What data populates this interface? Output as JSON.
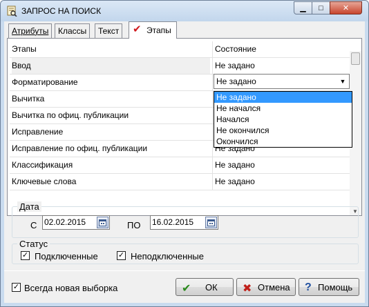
{
  "window": {
    "title": "ЗАПРОС НА ПОИСК",
    "min_glyph": "▁",
    "max_glyph": "□",
    "close_glyph": "✕"
  },
  "tabs": [
    {
      "label": "Атрибуты",
      "active": false
    },
    {
      "label": "Классы",
      "active": false
    },
    {
      "label": "Текст",
      "active": false
    },
    {
      "label": "Этапы",
      "active": true
    }
  ],
  "tab_check_glyph": "✔",
  "grid": {
    "headers": {
      "stage": "Этапы",
      "state": "Состояние"
    },
    "rows": [
      {
        "stage": "Ввод",
        "state": "Не задано"
      },
      {
        "stage": "Форматирование",
        "state": ""
      },
      {
        "stage": "Вычитка",
        "state": ""
      },
      {
        "stage": "Вычитка по офиц. публикации",
        "state": ""
      },
      {
        "stage": "Исправление",
        "state": "Не задано"
      },
      {
        "stage": "Исправление по офиц. публикации",
        "state": "Не задано"
      },
      {
        "stage": "Классификация",
        "state": "Не задано"
      },
      {
        "stage": "Ключевые слова",
        "state": "Не задано"
      }
    ]
  },
  "combo": {
    "value": "Не задано",
    "arrow": "▼",
    "options": [
      "Не задано",
      "Не начался",
      "Начался",
      "Не окончился",
      "Окончился"
    ],
    "selected_index": 0
  },
  "date_group": {
    "legend": "Дата",
    "from_label": "С",
    "from_value": "02.02.2015",
    "to_label": "ПО",
    "to_value": "16.02.2015"
  },
  "status_group": {
    "legend": "Статус",
    "connected_label": "Подключенные",
    "connected_checked": true,
    "disconnected_label": "Неподключенные",
    "disconnected_checked": true
  },
  "always_new_label": "Всегда новая выборка",
  "always_new_checked": true,
  "check_glyph": "✓",
  "buttons": {
    "ok": "ОК",
    "cancel": "Отмена",
    "help": "Помощь"
  },
  "colors": {
    "ok_icon": "#2a8a1c",
    "cancel_icon": "#c0201a",
    "help_icon": "#2050a0",
    "selection": "#3399ff"
  }
}
